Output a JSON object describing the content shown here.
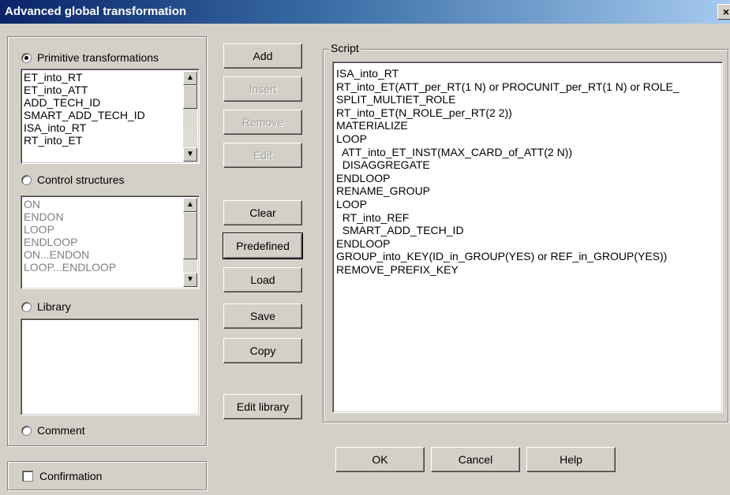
{
  "window": {
    "title": "Advanced global transformation",
    "close_glyph": "×"
  },
  "left": {
    "primitive_label": "Primitive transformations",
    "primitive_items": [
      "ET_into_RT",
      "ET_into_ATT",
      "ADD_TECH_ID",
      "SMART_ADD_TECH_ID",
      "ISA_into_RT",
      "RT_into_ET"
    ],
    "control_label": "Control structures",
    "control_items": [
      "ON",
      "ENDON",
      "LOOP",
      "ENDLOOP",
      "ON...ENDON",
      "LOOP...ENDLOOP"
    ],
    "library_label": "Library",
    "comment_label": "Comment",
    "confirmation_label": "Confirmation"
  },
  "buttons": {
    "add": "Add",
    "insert": "Insert",
    "remove": "Remove",
    "edit": "Edit",
    "clear": "Clear",
    "predefined": "Predefined",
    "load": "Load",
    "save": "Save",
    "copy": "Copy",
    "edit_library": "Edit library"
  },
  "script": {
    "label": "Script",
    "lines": [
      "ISA_into_RT",
      "RT_into_ET(ATT_per_RT(1 N) or PROCUNIT_per_RT(1 N) or ROLE_",
      "SPLIT_MULTIET_ROLE",
      "RT_into_ET(N_ROLE_per_RT(2 2))",
      "MATERIALIZE",
      "LOOP",
      "  ATT_into_ET_INST(MAX_CARD_of_ATT(2 N))",
      "  DISAGGREGATE",
      "ENDLOOP",
      "RENAME_GROUP",
      "LOOP",
      "  RT_into_REF",
      "  SMART_ADD_TECH_ID",
      "ENDLOOP",
      "GROUP_into_KEY(ID_in_GROUP(YES) or REF_in_GROUP(YES))",
      "REMOVE_PREFIX_KEY"
    ]
  },
  "footer": {
    "ok": "OK",
    "cancel": "Cancel",
    "help": "Help"
  },
  "icons": {
    "scroll_up": "▲",
    "scroll_down": "▼"
  }
}
